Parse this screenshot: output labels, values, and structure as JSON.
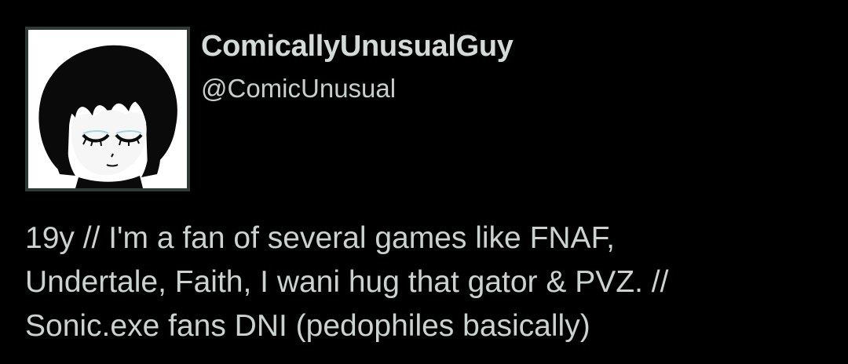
{
  "profile": {
    "display_name": "ComicallyUnusualGuy",
    "handle": "@ComicUnusual",
    "avatar_icon": "anime-girl-portrait",
    "bio_lines": [
      "19y // I'm a fan of several games like FNAF,",
      "Undertale, Faith, I wani hug that gator & PVZ. //",
      "Sonic.exe fans DNI (pedophiles basically)"
    ]
  },
  "colors": {
    "background": "#000000",
    "text": "#cfd9de",
    "avatar_border": "#2e3b37"
  }
}
